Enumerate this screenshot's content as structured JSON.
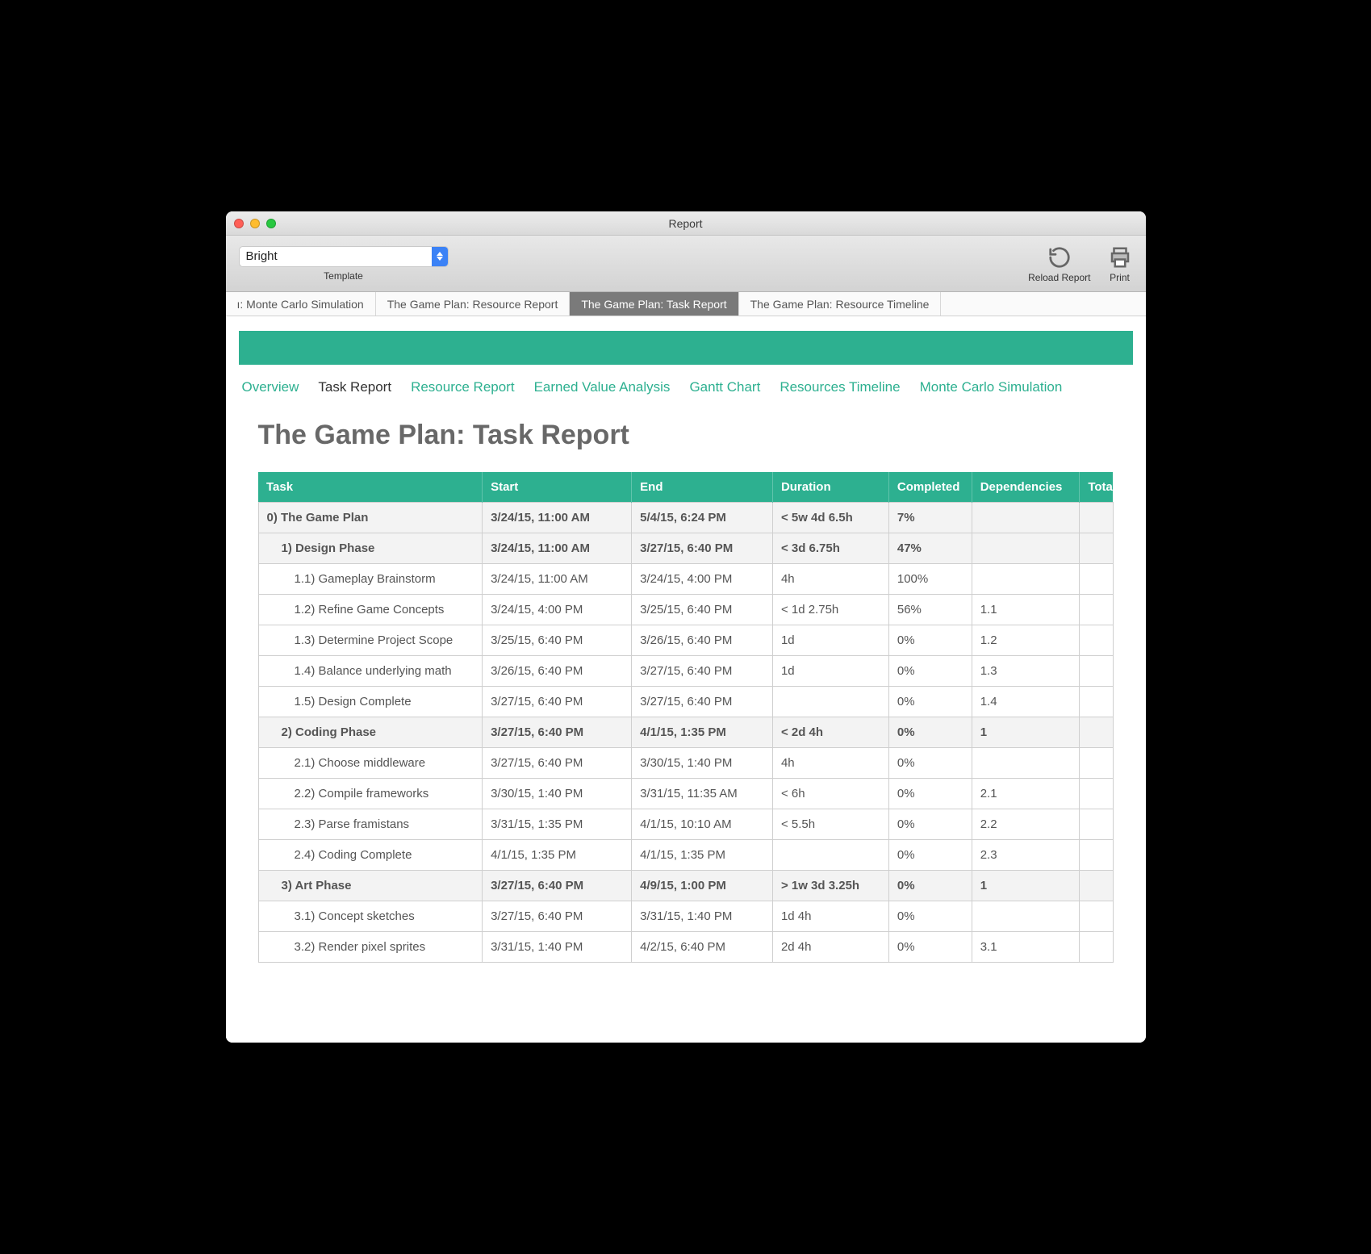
{
  "window_title": "Report",
  "toolbar": {
    "template_value": "Bright",
    "template_label": "Template",
    "reload_label": "Reload Report",
    "print_label": "Print"
  },
  "tabs": [
    {
      "label": "ı: Monte Carlo Simulation",
      "active": false
    },
    {
      "label": "The Game Plan: Resource Report",
      "active": false
    },
    {
      "label": "The Game Plan: Task Report",
      "active": true
    },
    {
      "label": "The Game Plan: Resource Timeline",
      "active": false
    }
  ],
  "report_nav": [
    {
      "label": "Overview",
      "current": false
    },
    {
      "label": "Task Report",
      "current": true
    },
    {
      "label": "Resource Report",
      "current": false
    },
    {
      "label": "Earned Value Analysis",
      "current": false
    },
    {
      "label": "Gantt Chart",
      "current": false
    },
    {
      "label": "Resources Timeline",
      "current": false
    },
    {
      "label": "Monte Carlo Simulation",
      "current": false
    }
  ],
  "doc_title": "The Game Plan: Task Report",
  "columns": [
    "Task",
    "Start",
    "End",
    "Duration",
    "Completed",
    "Dependencies",
    "Tota"
  ],
  "rows": [
    {
      "level": 0,
      "group": true,
      "task": "0) The Game Plan",
      "start": "3/24/15, 11:00 AM",
      "end": "5/4/15, 6:24 PM",
      "duration": "< 5w 4d 6.5h",
      "completed": "7%",
      "deps": "",
      "tot": ""
    },
    {
      "level": 1,
      "group": true,
      "task": "1) Design Phase",
      "start": "3/24/15, 11:00 AM",
      "end": "3/27/15, 6:40 PM",
      "duration": "< 3d 6.75h",
      "completed": "47%",
      "deps": "",
      "tot": ""
    },
    {
      "level": 2,
      "group": false,
      "task": "1.1) Gameplay Brainstorm",
      "start": "3/24/15, 11:00 AM",
      "end": "3/24/15, 4:00 PM",
      "duration": "4h",
      "completed": "100%",
      "deps": "",
      "tot": ""
    },
    {
      "level": 2,
      "group": false,
      "task": "1.2) Refine Game Concepts",
      "start": "3/24/15, 4:00 PM",
      "end": "3/25/15, 6:40 PM",
      "duration": "< 1d 2.75h",
      "completed": "56%",
      "deps": "1.1",
      "tot": ""
    },
    {
      "level": 2,
      "group": false,
      "task": "1.3) Determine Project Scope",
      "start": "3/25/15, 6:40 PM",
      "end": "3/26/15, 6:40 PM",
      "duration": "1d",
      "completed": "0%",
      "deps": "1.2",
      "tot": ""
    },
    {
      "level": 2,
      "group": false,
      "task": "1.4) Balance underlying math",
      "start": "3/26/15, 6:40 PM",
      "end": "3/27/15, 6:40 PM",
      "duration": "1d",
      "completed": "0%",
      "deps": "1.3",
      "tot": ""
    },
    {
      "level": 2,
      "group": false,
      "task": "1.5) Design Complete",
      "start": "3/27/15, 6:40 PM",
      "end": "3/27/15, 6:40 PM",
      "duration": "",
      "completed": "0%",
      "deps": "1.4",
      "tot": ""
    },
    {
      "level": 1,
      "group": true,
      "task": "2) Coding Phase",
      "start": "3/27/15, 6:40 PM",
      "end": "4/1/15, 1:35 PM",
      "duration": "< 2d 4h",
      "completed": "0%",
      "deps": "1",
      "tot": ""
    },
    {
      "level": 2,
      "group": false,
      "task": "2.1) Choose middleware",
      "start": "3/27/15, 6:40 PM",
      "end": "3/30/15, 1:40 PM",
      "duration": "4h",
      "completed": "0%",
      "deps": "",
      "tot": ""
    },
    {
      "level": 2,
      "group": false,
      "task": "2.2) Compile frameworks",
      "start": "3/30/15, 1:40 PM",
      "end": "3/31/15, 11:35 AM",
      "duration": "< 6h",
      "completed": "0%",
      "deps": "2.1",
      "tot": ""
    },
    {
      "level": 2,
      "group": false,
      "task": "2.3) Parse framistans",
      "start": "3/31/15, 1:35 PM",
      "end": "4/1/15, 10:10 AM",
      "duration": "< 5.5h",
      "completed": "0%",
      "deps": "2.2",
      "tot": ""
    },
    {
      "level": 2,
      "group": false,
      "task": "2.4) Coding Complete",
      "start": "4/1/15, 1:35 PM",
      "end": "4/1/15, 1:35 PM",
      "duration": "",
      "completed": "0%",
      "deps": "2.3",
      "tot": ""
    },
    {
      "level": 1,
      "group": true,
      "task": "3) Art Phase",
      "start": "3/27/15, 6:40 PM",
      "end": "4/9/15, 1:00 PM",
      "duration": "> 1w 3d 3.25h",
      "completed": "0%",
      "deps": "1",
      "tot": ""
    },
    {
      "level": 2,
      "group": false,
      "task": "3.1) Concept sketches",
      "start": "3/27/15, 6:40 PM",
      "end": "3/31/15, 1:40 PM",
      "duration": "1d 4h",
      "completed": "0%",
      "deps": "",
      "tot": ""
    },
    {
      "level": 2,
      "group": false,
      "task": "3.2) Render pixel sprites",
      "start": "3/31/15, 1:40 PM",
      "end": "4/2/15, 6:40 PM",
      "duration": "2d 4h",
      "completed": "0%",
      "deps": "3.1",
      "tot": ""
    }
  ]
}
